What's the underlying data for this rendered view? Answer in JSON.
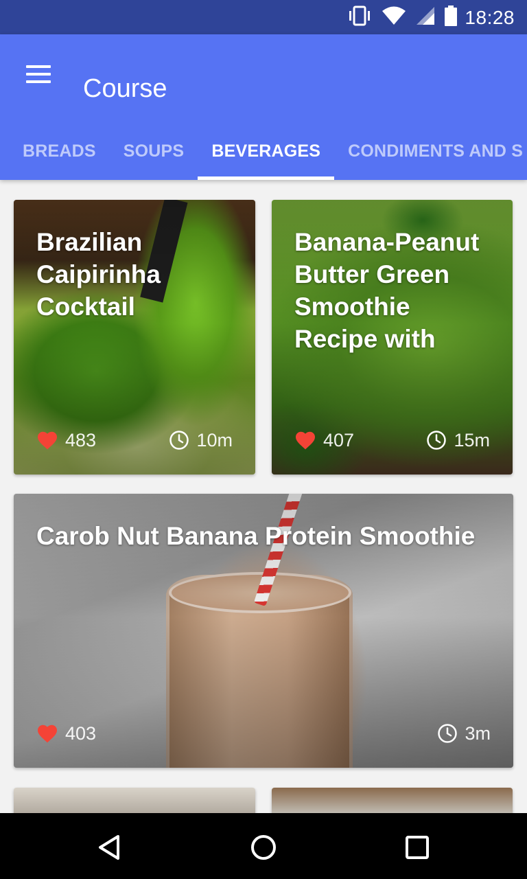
{
  "status_bar": {
    "time": "18:28",
    "icons": [
      "vibrate-icon",
      "wifi-icon",
      "cell-signal-icon",
      "battery-icon"
    ]
  },
  "app_bar": {
    "title": "Course",
    "menu_icon": "hamburger-menu-icon",
    "colors": {
      "status_bar": "#2f4498",
      "app_bar": "#5673f3"
    }
  },
  "tabs": [
    {
      "label": "BREADS",
      "active": false
    },
    {
      "label": "SOUPS",
      "active": false
    },
    {
      "label": "BEVERAGES",
      "active": true
    },
    {
      "label": "CONDIMENTS AND S",
      "active": false
    }
  ],
  "recipes": [
    {
      "title": "Brazilian Caipirinha Cocktail",
      "likes": "483",
      "time": "10m"
    },
    {
      "title": "Banana-Peanut Butter Green Smoothie Recipe with",
      "likes": "407",
      "time": "15m"
    },
    {
      "title": "Carob Nut Banana Protein Smoothie",
      "likes": "403",
      "time": "3m"
    }
  ],
  "nav_bar": {
    "icons": [
      "back-icon",
      "home-icon",
      "recents-icon"
    ]
  },
  "colors": {
    "heart": "#f44336"
  }
}
